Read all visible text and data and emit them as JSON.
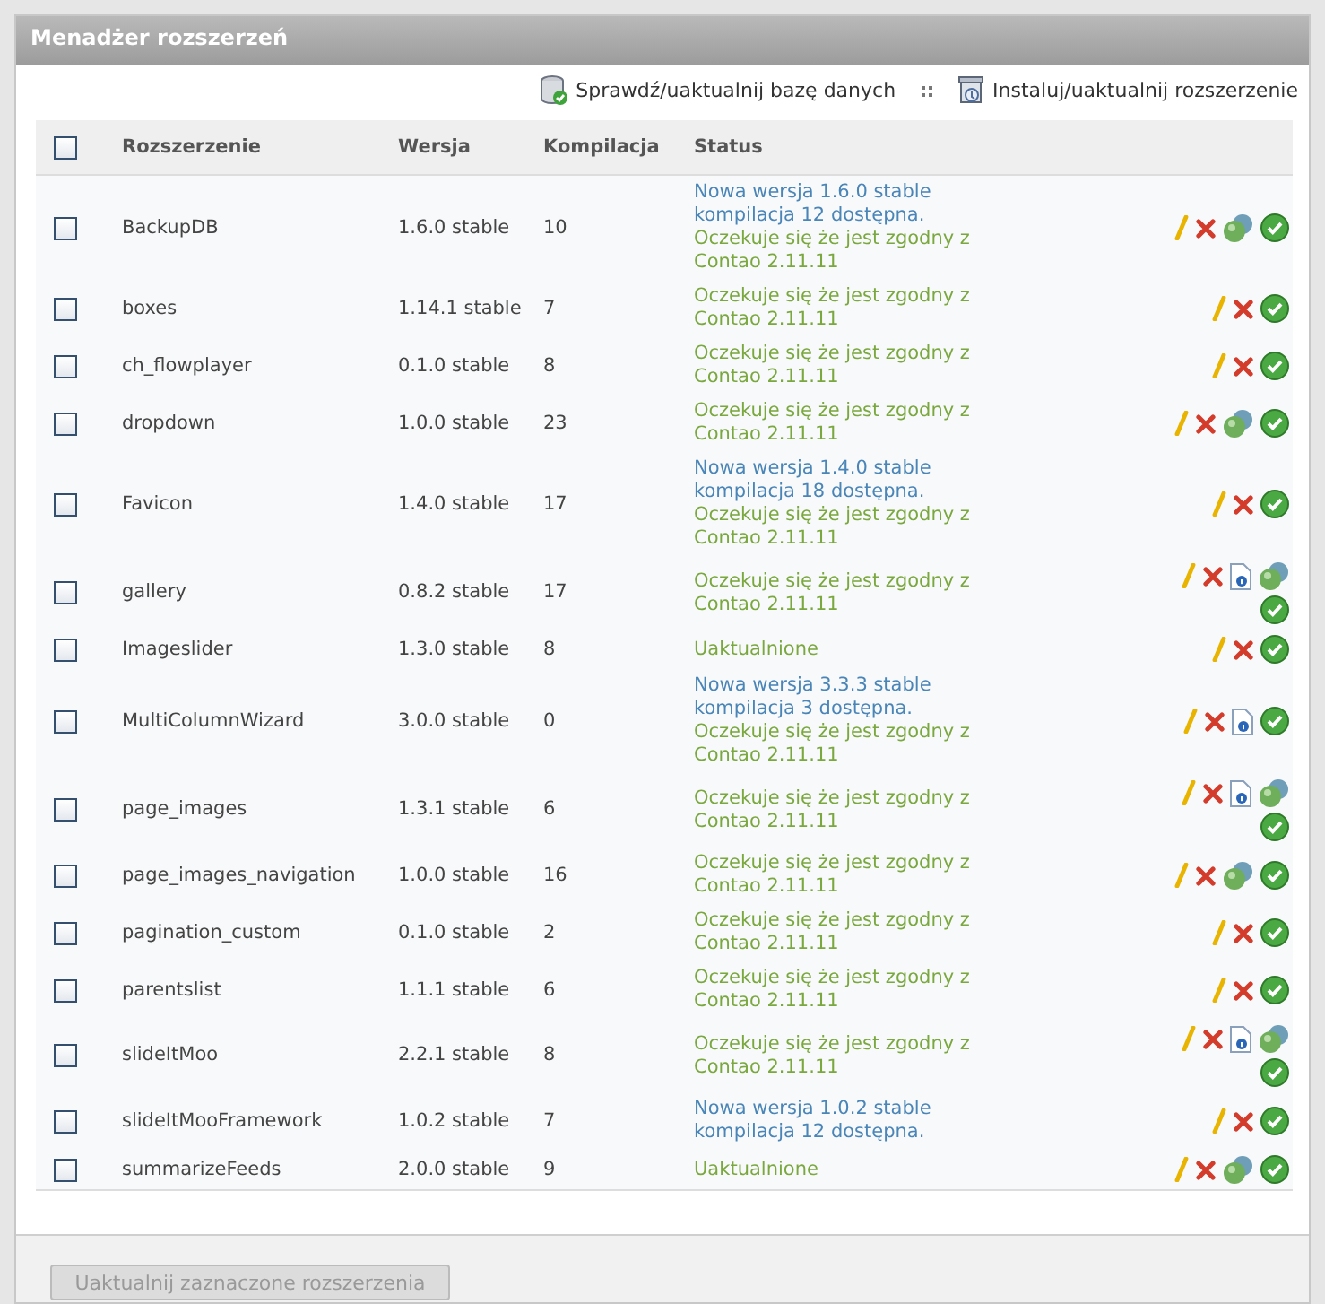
{
  "panel": {
    "title": "Menadżer rozszerzeń"
  },
  "toolbar": [
    {
      "kind": "database",
      "label": "Sprawdź/uaktualnij bazę danych"
    },
    {
      "kind": "install",
      "label": "Instaluj/uaktualnij rozszerzenie"
    }
  ],
  "table": {
    "select_all": {
      "checked": false
    },
    "columns": [
      "Rozszerzenie",
      "Wersja",
      "Kompilacja",
      "Status"
    ],
    "rows": [
      {
        "checked": false,
        "name": "BackupDB",
        "version": "1.6.0 stable",
        "build": "10",
        "status": [
          {
            "kind": "update",
            "text": "Nowa wersja 1.6.0 stable kompilacja 12 dostępna."
          },
          {
            "kind": "note",
            "text": "Oczekuje się że jest zgodny z Contao 2.11.11"
          }
        ],
        "actions": [
          {
            "kind": "edit"
          },
          {
            "kind": "delete"
          },
          {
            "kind": "sphere"
          },
          {
            "kind": "ok"
          }
        ]
      },
      {
        "checked": false,
        "name": "boxes",
        "version": "1.14.1 stable",
        "build": "7",
        "status": [
          {
            "kind": "note",
            "text": "Oczekuje się że jest zgodny z Contao 2.11.11"
          }
        ],
        "actions": [
          {
            "kind": "edit"
          },
          {
            "kind": "delete"
          },
          {
            "kind": "ok"
          }
        ]
      },
      {
        "checked": false,
        "name": "ch_flowplayer",
        "version": "0.1.0 stable",
        "build": "8",
        "status": [
          {
            "kind": "note",
            "text": "Oczekuje się że jest zgodny z Contao 2.11.11"
          }
        ],
        "actions": [
          {
            "kind": "edit"
          },
          {
            "kind": "delete"
          },
          {
            "kind": "ok"
          }
        ]
      },
      {
        "checked": false,
        "name": "dropdown",
        "version": "1.0.0 stable",
        "build": "23",
        "status": [
          {
            "kind": "note",
            "text": "Oczekuje się że jest zgodny z Contao 2.11.11"
          }
        ],
        "actions": [
          {
            "kind": "edit"
          },
          {
            "kind": "delete"
          },
          {
            "kind": "sphere"
          },
          {
            "kind": "ok"
          }
        ]
      },
      {
        "checked": false,
        "name": "Favicon",
        "version": "1.4.0 stable",
        "build": "17",
        "status": [
          {
            "kind": "update",
            "text": "Nowa wersja 1.4.0 stable kompilacja 18 dostępna."
          },
          {
            "kind": "note",
            "text": "Oczekuje się że jest zgodny z Contao 2.11.11"
          }
        ],
        "actions": [
          {
            "kind": "edit"
          },
          {
            "kind": "delete"
          },
          {
            "kind": "ok"
          }
        ]
      },
      {
        "checked": false,
        "name": "gallery",
        "version": "0.8.2 stable",
        "build": "17",
        "status": [
          {
            "kind": "note",
            "text": "Oczekuje się że jest zgodny z Contao 2.11.11"
          }
        ],
        "actions": [
          {
            "kind": "edit"
          },
          {
            "kind": "delete"
          },
          {
            "kind": "info"
          },
          {
            "kind": "sphere"
          },
          {
            "kind": "ok"
          }
        ]
      },
      {
        "checked": false,
        "name": "Imageslider",
        "version": "1.3.0 stable",
        "build": "8",
        "status": [
          {
            "kind": "note",
            "text": "Uaktualnione"
          }
        ],
        "actions": [
          {
            "kind": "edit"
          },
          {
            "kind": "delete"
          },
          {
            "kind": "ok"
          }
        ]
      },
      {
        "checked": false,
        "name": "MultiColumnWizard",
        "version": "3.0.0 stable",
        "build": "0",
        "status": [
          {
            "kind": "update",
            "text": "Nowa wersja 3.3.3 stable kompilacja 3 dostępna."
          },
          {
            "kind": "note",
            "text": "Oczekuje się że jest zgodny z Contao 2.11.11"
          }
        ],
        "actions": [
          {
            "kind": "edit"
          },
          {
            "kind": "delete"
          },
          {
            "kind": "info"
          },
          {
            "kind": "ok"
          }
        ]
      },
      {
        "checked": false,
        "name": "page_images",
        "version": "1.3.1 stable",
        "build": "6",
        "status": [
          {
            "kind": "note",
            "text": "Oczekuje się że jest zgodny z Contao 2.11.11"
          }
        ],
        "actions": [
          {
            "kind": "edit"
          },
          {
            "kind": "delete"
          },
          {
            "kind": "info"
          },
          {
            "kind": "sphere"
          },
          {
            "kind": "ok"
          }
        ]
      },
      {
        "checked": false,
        "name": "page_images_navigation",
        "version": "1.0.0 stable",
        "build": "16",
        "status": [
          {
            "kind": "note",
            "text": "Oczekuje się że jest zgodny z Contao 2.11.11"
          }
        ],
        "actions": [
          {
            "kind": "edit"
          },
          {
            "kind": "delete"
          },
          {
            "kind": "sphere"
          },
          {
            "kind": "ok"
          }
        ]
      },
      {
        "checked": false,
        "name": "pagination_custom",
        "version": "0.1.0 stable",
        "build": "2",
        "status": [
          {
            "kind": "note",
            "text": "Oczekuje się że jest zgodny z Contao 2.11.11"
          }
        ],
        "actions": [
          {
            "kind": "edit"
          },
          {
            "kind": "delete"
          },
          {
            "kind": "ok"
          }
        ]
      },
      {
        "checked": false,
        "name": "parentslist",
        "version": "1.1.1 stable",
        "build": "6",
        "status": [
          {
            "kind": "note",
            "text": "Oczekuje się że jest zgodny z Contao 2.11.11"
          }
        ],
        "actions": [
          {
            "kind": "edit"
          },
          {
            "kind": "delete"
          },
          {
            "kind": "ok"
          }
        ]
      },
      {
        "checked": false,
        "name": "slideItMoo",
        "version": "2.2.1 stable",
        "build": "8",
        "status": [
          {
            "kind": "note",
            "text": "Oczekuje się że jest zgodny z Contao 2.11.11"
          }
        ],
        "actions": [
          {
            "kind": "edit"
          },
          {
            "kind": "delete"
          },
          {
            "kind": "info"
          },
          {
            "kind": "sphere"
          },
          {
            "kind": "ok"
          }
        ]
      },
      {
        "checked": false,
        "name": "slideItMooFramework",
        "version": "1.0.2 stable",
        "build": "7",
        "status": [
          {
            "kind": "update",
            "text": "Nowa wersja 1.0.2 stable kompilacja 12 dostępna."
          }
        ],
        "actions": [
          {
            "kind": "edit"
          },
          {
            "kind": "delete"
          },
          {
            "kind": "ok"
          }
        ]
      },
      {
        "checked": false,
        "name": "summarizeFeeds",
        "version": "2.0.0 stable",
        "build": "9",
        "status": [
          {
            "kind": "note",
            "text": "Uaktualnione"
          }
        ],
        "actions": [
          {
            "kind": "edit"
          },
          {
            "kind": "delete"
          },
          {
            "kind": "sphere"
          },
          {
            "kind": "ok"
          }
        ]
      }
    ]
  },
  "update_button": {
    "label": "Uaktualnij zaznaczone rozszerzenia",
    "disabled": true
  }
}
